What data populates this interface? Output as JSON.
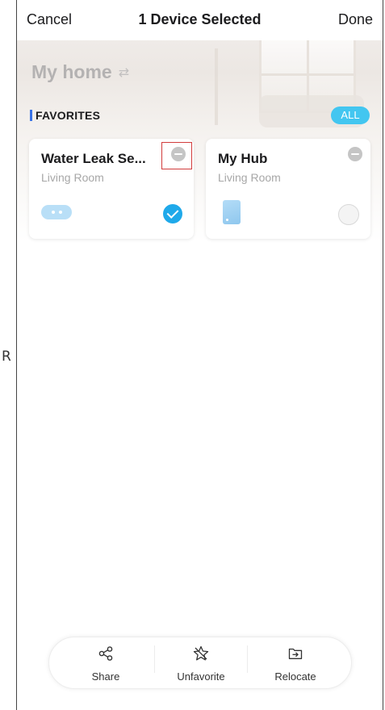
{
  "outside_glyph": "R",
  "header": {
    "cancel_label": "Cancel",
    "title": "1 Device Selected",
    "done_label": "Done"
  },
  "home": {
    "name": "My home",
    "switch_icon": "swap-arrows-icon",
    "switch_glyph": "⇄"
  },
  "favorites": {
    "section_label": "FAVORITES",
    "all_label": "ALL",
    "devices": [
      {
        "name": "Water Leak Se...",
        "room": "Living Room",
        "selected": true,
        "icon": "water-leak-sensor-icon"
      },
      {
        "name": "My Hub",
        "room": "Living Room",
        "selected": false,
        "icon": "hub-icon"
      }
    ]
  },
  "actions": {
    "share_label": "Share",
    "unfavorite_label": "Unfavorite",
    "relocate_label": "Relocate"
  },
  "colors": {
    "accent_blue": "#1fa9ea",
    "all_button": "#43c6f0",
    "section_bar": "#3a73e6",
    "highlight": "#d23c3c",
    "muted_text": "#a7a7a7"
  }
}
